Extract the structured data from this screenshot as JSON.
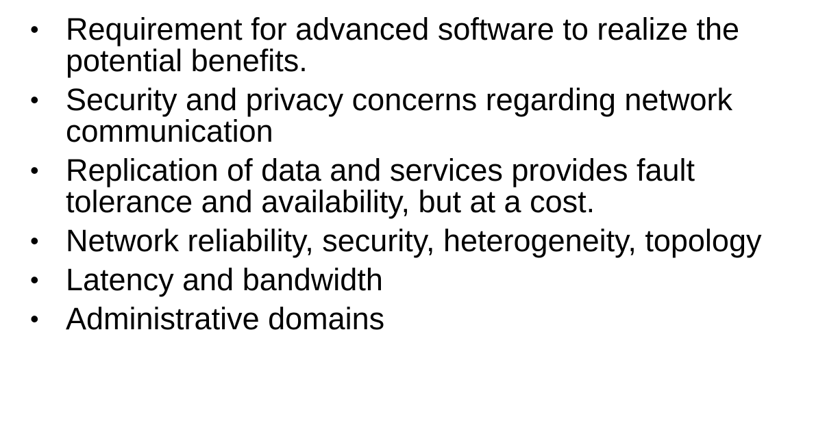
{
  "bullet_glyph": "•",
  "bullets": [
    {
      "text": "Requirement for advanced software to realize the potential benefits."
    },
    {
      "text": "Security and privacy concerns regarding network communication"
    },
    {
      "text": "Replication of data and services provides fault tolerance and availability, but at a cost."
    },
    {
      "text": "Network reliability, security, heterogeneity, topology"
    },
    {
      "text": "Latency and bandwidth"
    },
    {
      "text": "Administrative domains"
    }
  ]
}
